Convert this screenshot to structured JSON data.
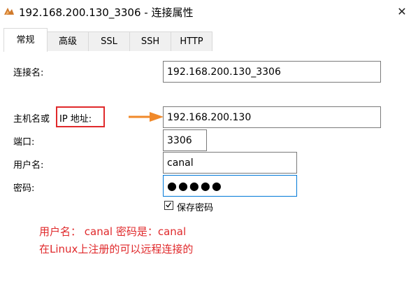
{
  "window": {
    "title": "192.168.200.130_3306 - 连接属性",
    "close_glyph": "✕"
  },
  "tabs": [
    {
      "label": "常规",
      "active": true
    },
    {
      "label": "高级",
      "active": false
    },
    {
      "label": "SSL",
      "active": false
    },
    {
      "label": "SSH",
      "active": false
    },
    {
      "label": "HTTP",
      "active": false
    }
  ],
  "form": {
    "connection_name_label": "连接名:",
    "connection_name_value": "192.168.200.130_3306",
    "host_label_prefix": "主机名或",
    "host_label_highlight": "IP 地址:",
    "host_value": "192.168.200.130",
    "port_label": "端口:",
    "port_value": "3306",
    "user_label": "用户名:",
    "user_value": "canal",
    "password_label": "密码:",
    "password_masked": "●●●●●",
    "save_password_label": "保存密码",
    "save_password_checked": true
  },
  "annotation": {
    "line1": "用户名： canal  密码是：canal",
    "line2": "在Linux上注册的可以远程连接的",
    "color": "#e0292b",
    "arrow_color": "#f0892a"
  }
}
